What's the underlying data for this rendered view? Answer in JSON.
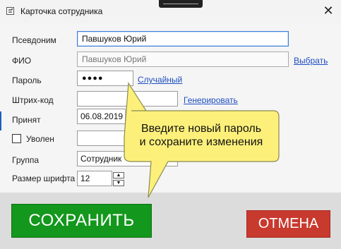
{
  "window": {
    "title": "Карточка сотрудника",
    "close_glyph": "✕"
  },
  "form": {
    "nickname_label": "Псевдоним",
    "nickname_value": "Павшуков Юрий",
    "fullname_label": "ФИО",
    "fullname_value": "Павшуков Юрий",
    "select_link": "Выбрать",
    "password_label": "Пароль",
    "password_value": "●●●●",
    "random_link": "Случайный",
    "barcode_label": "Штрих-код",
    "barcode_value": "",
    "generate_link": "Генерировать",
    "hired_label": "Принят",
    "hired_value": "06.08.2019",
    "fired_label": "Уволен",
    "fired_checked": false,
    "fired_value": "",
    "group_label": "Группа",
    "group_value": "Сотрудник",
    "font_size_label": "Размер шрифта",
    "font_size_value": "12",
    "spinner_up": "▲",
    "spinner_down": "▼"
  },
  "tooltip": {
    "line1": "Введите новый пароль",
    "line2": "и сохраните изменения",
    "fill_color": "#fdf07a",
    "stroke_color": "#8a8a55"
  },
  "actions": {
    "save_label": "СОХРАНИТЬ",
    "cancel_label": "ОТМЕНА",
    "save_color": "#13971c",
    "cancel_color": "#c8392e"
  },
  "icons": {
    "app": "card-icon",
    "close": "close-icon"
  }
}
